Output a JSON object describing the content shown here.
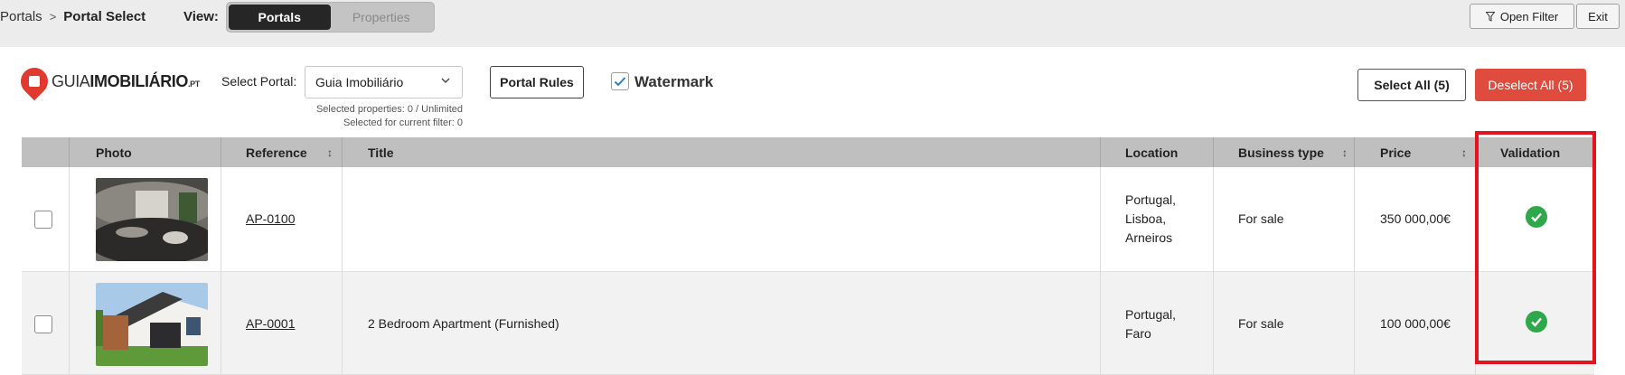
{
  "breadcrumb": {
    "root": "Portals",
    "separator": ">",
    "current": "Portal Select"
  },
  "view": {
    "label": "View:",
    "options": [
      {
        "label": "Portals",
        "active": true
      },
      {
        "label": "Properties",
        "active": false
      }
    ]
  },
  "toolbar": {
    "open_filter_label": "Open Filter",
    "filter_icon": "funnel-icon",
    "exit_label": "Exit"
  },
  "portal": {
    "logo": {
      "part1": "GUIA",
      "part2": "IMOBILIÁRIO",
      "suffix": ".PT",
      "color": "#e03a2f"
    },
    "select_label": "Select Portal:",
    "selected": "Guia Imobiliário",
    "selected_info": "Selected properties: 0 / Unlimited",
    "filter_info": "Selected for current filter: 0",
    "rules_label": "Portal Rules",
    "watermark_label": "Watermark",
    "watermark_checked": true,
    "select_all_label": "Select All (5)",
    "deselect_all_label": "Deselect All (5)",
    "deselect_color": "#df4c3d"
  },
  "table": {
    "columns": [
      "Photo",
      "Reference",
      "Title",
      "Location",
      "Business type",
      "Price",
      "Validation"
    ],
    "sortable": [
      "Reference",
      "Business type",
      "Price"
    ],
    "rows": [
      {
        "checked": false,
        "reference": "AP-0100",
        "title": "",
        "location": [
          "Portugal,",
          "Lisboa,",
          "Arneiros"
        ],
        "business_type": "For sale",
        "price": "350 000,00€",
        "valid": true
      },
      {
        "checked": false,
        "reference": "AP-0001",
        "title": "2 Bedroom Apartment (Furnished)",
        "location": [
          "Portugal,",
          "Faro"
        ],
        "business_type": "For sale",
        "price": "100 000,00€",
        "valid": true
      }
    ]
  },
  "colors": {
    "valid": "#2ea84a",
    "highlight": "#e2141f",
    "active_segment": "#262626"
  }
}
